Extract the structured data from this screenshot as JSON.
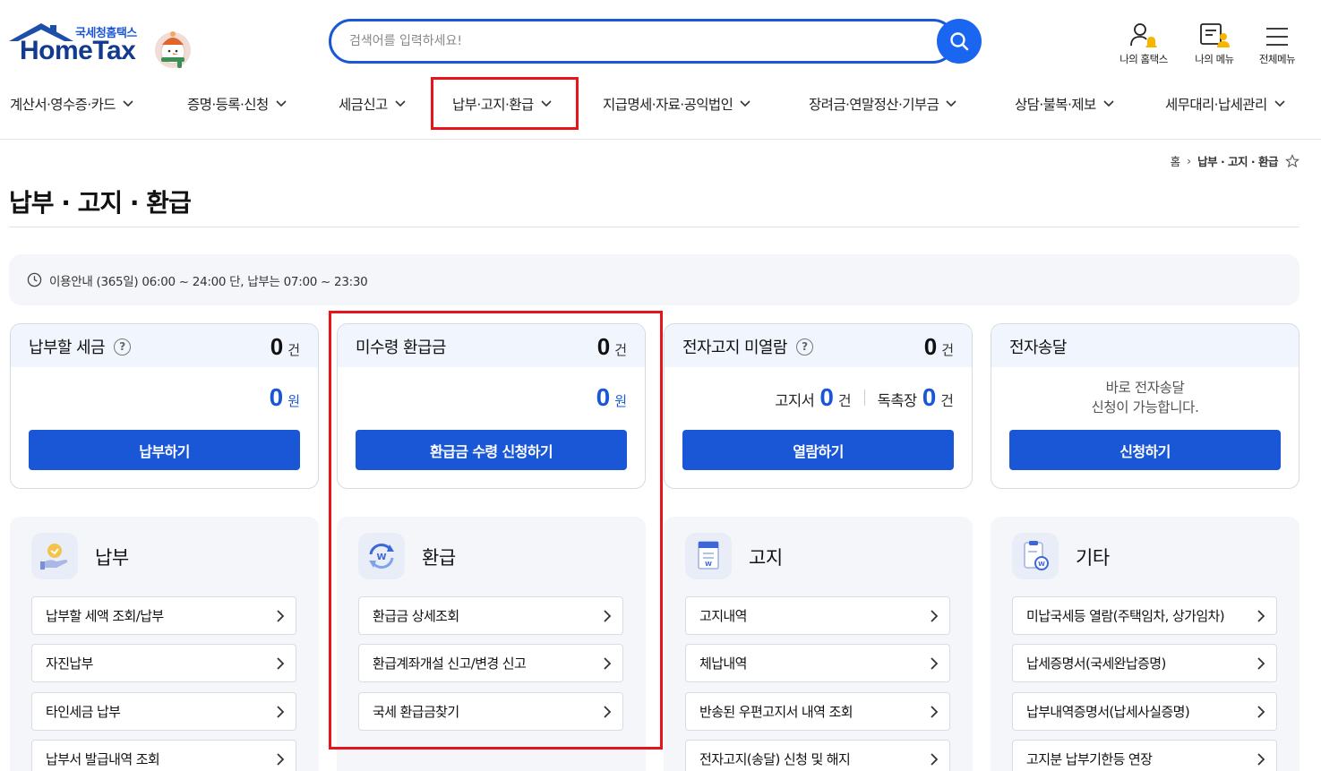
{
  "header": {
    "logo_small": "국세청홈택스",
    "logo_main": "HomeTax",
    "search_placeholder": "검색어를 입력하세요!",
    "util": [
      {
        "label": "나의 홈택스",
        "icon": "user-bell-icon"
      },
      {
        "label": "나의 메뉴",
        "icon": "menu-user-icon"
      },
      {
        "label": "전체메뉴",
        "icon": "hamburger-icon"
      }
    ],
    "colors": {
      "brand": "#1a57d6",
      "search_btn": "#1a66f0",
      "annotation": "#e8141c"
    }
  },
  "gnb": [
    {
      "label": "계산서·영수증·카드"
    },
    {
      "label": "증명·등록·신청"
    },
    {
      "label": "세금신고"
    },
    {
      "label": "납부·고지·환급"
    },
    {
      "label": "지급명세·자료·공익법인"
    },
    {
      "label": "장려금·연말정산·기부금"
    },
    {
      "label": "상담·불복·제보"
    },
    {
      "label": "세무대리·납세관리"
    }
  ],
  "breadcrumb": {
    "home": "홈",
    "sep": "›",
    "current": "납부 · 고지 · 환급"
  },
  "page_title": "납부 · 고지 · 환급",
  "notice": "이용안내 (365일) 06:00 ~ 24:00 단, 납부는 07:00 ~ 23:30",
  "cards": {
    "payment": {
      "title": "납부할 세금",
      "help": "?",
      "count": "0",
      "count_unit": "건",
      "amount": "0",
      "amount_unit": "원",
      "button": "납부하기"
    },
    "refund": {
      "title": "미수령 환급금",
      "count": "0",
      "count_unit": "건",
      "amount": "0",
      "amount_unit": "원",
      "button": "환급금 수령 신청하기"
    },
    "notice": {
      "title": "전자고지 미열람",
      "help": "?",
      "count": "0",
      "count_unit": "건",
      "bill_label": "고지서",
      "bill_count": "0",
      "bill_unit": "건",
      "reminder_label": "독촉장",
      "reminder_count": "0",
      "reminder_unit": "건",
      "button": "열람하기"
    },
    "delivery": {
      "title": "전자송달",
      "desc_line1": "바로 전자송달",
      "desc_line2": "신청이 가능합니다.",
      "button": "신청하기"
    }
  },
  "panels": {
    "pay": {
      "title": "납부",
      "links": [
        "납부할 세액 조회/납부",
        "자진납부",
        "타인세금 납부",
        "납부서 발급내역 조회"
      ]
    },
    "refund": {
      "title": "환급",
      "links": [
        "환급금 상세조회",
        "환급계좌개설 신고/변경 신고",
        "국세 환급금찾기"
      ]
    },
    "bill": {
      "title": "고지",
      "links": [
        "고지내역",
        "체납내역",
        "반송된 우편고지서 내역 조회",
        "전자고지(송달) 신청 및 해지"
      ]
    },
    "etc": {
      "title": "기타",
      "links": [
        "미납국세등 열람(주택임차, 상가임차)",
        "납세증명서(국세완납증명)",
        "납부내역증명서(납세사실증명)",
        "고지분 납부기한등 연장"
      ]
    }
  }
}
